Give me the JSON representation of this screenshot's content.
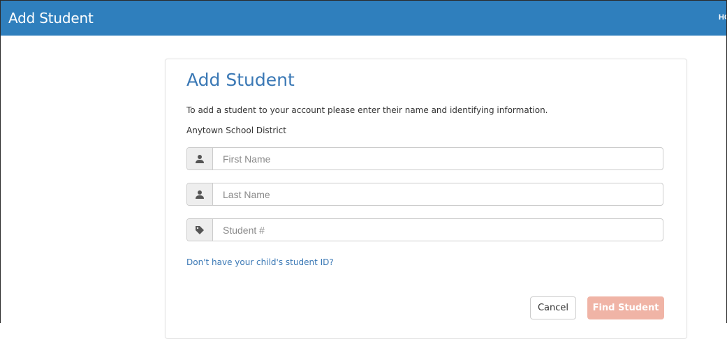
{
  "header": {
    "title": "Add Student",
    "home_label": "HOME"
  },
  "card": {
    "title": "Add Student",
    "instructions": "To add a student to your account please enter their name and identifying information.",
    "district": "Anytown School District"
  },
  "form": {
    "first_name": {
      "placeholder": "First Name",
      "icon": "user-icon",
      "value": ""
    },
    "last_name": {
      "placeholder": "Last Name",
      "icon": "user-icon",
      "value": ""
    },
    "student_number": {
      "placeholder": "Student #",
      "icon": "tag-icon",
      "value": ""
    }
  },
  "help_link": "Don't have your child's student ID?",
  "buttons": {
    "cancel_label": "Cancel",
    "find_label": "Find Student"
  },
  "colors": {
    "header_bg": "#2f7fbd",
    "title_blue": "#3a78b5",
    "find_button_disabled": "#f0b4a6"
  }
}
